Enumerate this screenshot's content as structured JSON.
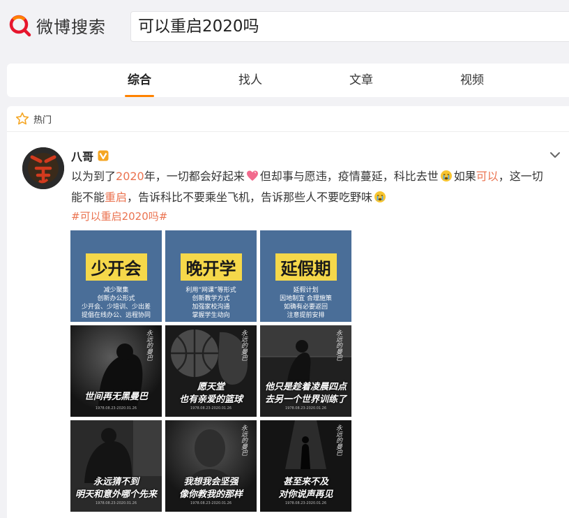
{
  "header": {
    "logo_text": "微博搜索",
    "search_value": "可以重启2020吗",
    "brand_color": "#e6162d"
  },
  "tabs": [
    {
      "label": "综合",
      "active": true
    },
    {
      "label": "找人",
      "active": false
    },
    {
      "label": "文章",
      "active": false
    },
    {
      "label": "视频",
      "active": false
    }
  ],
  "section": {
    "label": "热门",
    "icon": "star-icon"
  },
  "post": {
    "author": "八哥",
    "verified_icon": "verified-v-icon",
    "text": {
      "p1": "以为到了",
      "h1": "2020",
      "p2": "年，一切都会好起来",
      "p3": "但却事与愿违，疫情蔓延，科比去世",
      "p4": "如果",
      "h2": "可以",
      "p5": "，这一切能不能",
      "h3": "重启",
      "p6": "，告诉科比不要乘坐飞机，告诉那些人不要吃野味"
    },
    "hashtag": "#可以重启2020吗#",
    "images": [
      {
        "kind": "blue",
        "title": "少开会",
        "lines": [
          "减少聚集",
          "创新办公形式",
          "少开会、少培训、少出差",
          "提倡在线办公、远程协同"
        ]
      },
      {
        "kind": "blue",
        "title": "晚开学",
        "lines": [
          "利用“网课”等形式",
          "创新教学方式",
          "加强家校沟通",
          "掌握学生动向"
        ]
      },
      {
        "kind": "blue",
        "title": "延假期",
        "lines": [
          "延假计划",
          "因地制宜 合理施策",
          "如确有必要返回",
          "注意提前安排"
        ]
      },
      {
        "kind": "dark",
        "caption": [
          "世间再无黑曼巴"
        ],
        "sig": "永远的曼巴",
        "foot": "1978.08.23-2020.01.26"
      },
      {
        "kind": "dark",
        "caption": [
          "愿天堂",
          "也有亲爱的篮球"
        ],
        "sig": "永远的曼巴",
        "foot": "1978.08.23-2020.01.26"
      },
      {
        "kind": "dark",
        "caption": [
          "他只是趁着凌晨四点",
          "去另一个世界训练了"
        ],
        "sig": "永远的曼巴",
        "foot": "1978.08.23-2020.01.26"
      },
      {
        "kind": "dark",
        "caption": [
          "永远猜不到",
          "明天和意外哪个先来"
        ],
        "sig": "永远的曼巴",
        "foot": "1978.08.23-2020.01.26"
      },
      {
        "kind": "dark",
        "caption": [
          "我想我会坚强",
          "像你教我的那样"
        ],
        "sig": "永远的曼巴",
        "foot": "1978.08.23-2020.01.26"
      },
      {
        "kind": "dark",
        "caption": [
          "甚至来不及",
          "对你说声再见"
        ],
        "sig": "永远的曼巴",
        "foot": "1978.08.23-2020.01.26"
      }
    ]
  }
}
